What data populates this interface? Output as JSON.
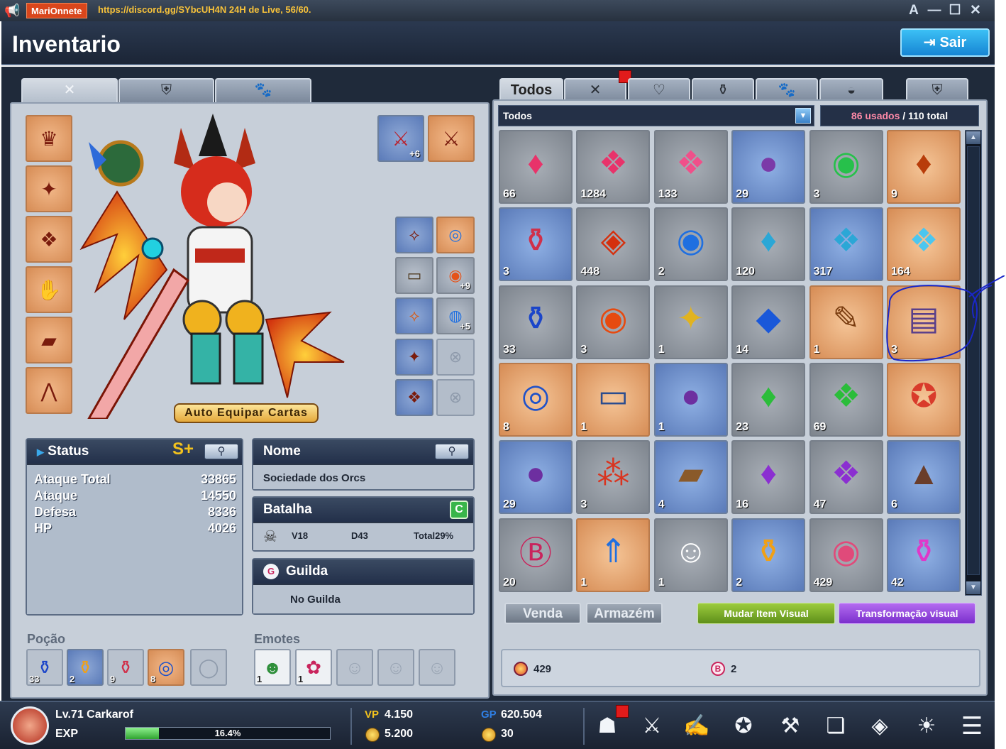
{
  "titlebar": {
    "app_name": "MariOnnete",
    "link_text": "https://discord.gg/SYbcUH4N 24H de Live, 56/60.",
    "controls": {
      "text_size": "A",
      "minimize": "—",
      "maximize": "☐",
      "close": "✕"
    }
  },
  "header": {
    "title": "Inventario",
    "exit_label": "Sair"
  },
  "left_tabs": [
    "weapon-icon",
    "armor-icon",
    "paw-icon"
  ],
  "equipment": {
    "auto_equip_label": "Auto Equipar Cartas",
    "weapon_upgrade": "+6",
    "accessory_upgrades": [
      "+9",
      "+5"
    ]
  },
  "status": {
    "title": "Status",
    "grade": "S+",
    "rows": [
      {
        "label": "Ataque Total",
        "value": "33865"
      },
      {
        "label": "Ataque",
        "value": "14550"
      },
      {
        "label": "Defesa",
        "value": "8336"
      },
      {
        "label": "HP",
        "value": "4026"
      }
    ]
  },
  "name_box": {
    "title": "Nome",
    "value": "Sociedade dos Orcs"
  },
  "battle_box": {
    "title": "Batalha",
    "v": "V18",
    "d": "D43",
    "total": "Total29%"
  },
  "guild_box": {
    "title": "Guilda",
    "value": "No Guilda"
  },
  "potions": {
    "title": "Poção",
    "items": [
      "33",
      "2",
      "9",
      "8"
    ]
  },
  "emotes": {
    "title": "Emotes",
    "items": [
      "1",
      "1"
    ]
  },
  "inventory": {
    "tab_all": "Todos",
    "filter_value": "Todos",
    "used": "86 usados",
    "total": " / 110 total",
    "items": [
      {
        "q": "66",
        "c": "gray",
        "i": "pink-crystal-icon",
        "g": "♦",
        "col": "#e8336a"
      },
      {
        "q": "1284",
        "c": "gray",
        "i": "pink-crystal-cluster-icon",
        "g": "❖",
        "col": "#e8336a"
      },
      {
        "q": "133",
        "c": "gray",
        "i": "pink-crystal-cluster-icon",
        "g": "❖",
        "col": "#f0508a"
      },
      {
        "q": "29",
        "c": "blue",
        "i": "purple-orb-icon",
        "g": "●",
        "col": "#7b3aa8"
      },
      {
        "q": "3",
        "c": "gray",
        "i": "green-orb-icon",
        "g": "◉",
        "col": "#27c04b"
      },
      {
        "q": "9",
        "c": "orange",
        "i": "orange-gem-icon",
        "g": "♦",
        "col": "#b83d0a"
      },
      {
        "q": "3",
        "c": "blue",
        "i": "red-potion-icon",
        "g": "⚱",
        "col": "#d0304a"
      },
      {
        "q": "448",
        "c": "gray",
        "i": "red-mask-icon",
        "g": "◈",
        "col": "#d4300e"
      },
      {
        "q": "2",
        "c": "gray",
        "i": "blue-orb-icon",
        "g": "◉",
        "col": "#1f6fe0"
      },
      {
        "q": "120",
        "c": "gray",
        "i": "cyan-crystal-icon",
        "g": "♦",
        "col": "#2ba7d6"
      },
      {
        "q": "317",
        "c": "blue",
        "i": "cyan-crystal-cluster-icon",
        "g": "❖",
        "col": "#2ba7d6"
      },
      {
        "q": "164",
        "c": "orange",
        "i": "cyan-crystal-cluster-icon",
        "g": "❖",
        "col": "#4cc6ef"
      },
      {
        "q": "33",
        "c": "gray",
        "i": "blue-potion-icon",
        "g": "⚱",
        "col": "#1b45c9"
      },
      {
        "q": "3",
        "c": "gray",
        "i": "fire-orb-icon",
        "g": "◉",
        "col": "#e64a10"
      },
      {
        "q": "1",
        "c": "gray",
        "i": "gold-pieces-icon",
        "g": "✦",
        "col": "#e1b31f"
      },
      {
        "q": "14",
        "c": "gray",
        "i": "blue-diamond-icon",
        "g": "◆",
        "col": "#1a58d9"
      },
      {
        "q": "1",
        "c": "orange",
        "i": "scroll-icon",
        "g": "✎",
        "col": "#7a3d10"
      },
      {
        "q": "3",
        "c": "orange",
        "i": "scroll-icon",
        "g": "▤",
        "col": "#5a3f8a"
      },
      {
        "q": "8",
        "c": "orange",
        "i": "ring-icon",
        "g": "◎",
        "col": "#1f52c9"
      },
      {
        "q": "1",
        "c": "orange",
        "i": "ticket-icon",
        "g": "▭",
        "col": "#2b4d8f"
      },
      {
        "q": "1",
        "c": "blue",
        "i": "purple-orb-icon",
        "g": "●",
        "col": "#6d2fa0"
      },
      {
        "q": "23",
        "c": "gray",
        "i": "green-crystal-icon",
        "g": "♦",
        "col": "#2bbd3a"
      },
      {
        "q": "69",
        "c": "gray",
        "i": "green-crystal-cluster-icon",
        "g": "❖",
        "col": "#2bbd3a"
      },
      {
        "q": "",
        "c": "orange",
        "i": "gc-club-badge-icon",
        "g": "✪",
        "col": "#d93b2b"
      },
      {
        "q": "29",
        "c": "blue",
        "i": "purple-orb-icon",
        "g": "●",
        "col": "#6d2fa0"
      },
      {
        "q": "3",
        "c": "gray",
        "i": "red-powder-icon",
        "g": "⁂",
        "col": "#d9341f"
      },
      {
        "q": "4",
        "c": "blue",
        "i": "treasure-map-icon",
        "g": "▰",
        "col": "#8a5a2a"
      },
      {
        "q": "16",
        "c": "gray",
        "i": "purple-crystal-icon",
        "g": "♦",
        "col": "#8b2fd1"
      },
      {
        "q": "47",
        "c": "gray",
        "i": "purple-crystal-cluster-icon",
        "g": "❖",
        "col": "#8b2fd1"
      },
      {
        "q": "6",
        "c": "blue",
        "i": "cannon-icon",
        "g": "▲",
        "col": "#6a3d2a"
      },
      {
        "q": "20",
        "c": "gray",
        "i": "b-coin-icon",
        "g": "Ⓑ",
        "col": "#c9245c"
      },
      {
        "q": "1",
        "c": "orange",
        "i": "up-scroll-icon",
        "g": "⇑",
        "col": "#1f6fe0"
      },
      {
        "q": "1",
        "c": "gray",
        "i": "white-ghost-icon",
        "g": "☺",
        "col": "#ffffff"
      },
      {
        "q": "2",
        "c": "blue",
        "i": "yellow-potion-icon",
        "g": "⚱",
        "col": "#f0a017"
      },
      {
        "q": "429",
        "c": "gray",
        "i": "rainbow-coin-icon",
        "g": "◉",
        "col": "#e04a7a"
      },
      {
        "q": "42",
        "c": "blue",
        "i": "pink-potion-icon",
        "g": "⚱",
        "col": "#e038c9"
      }
    ],
    "buttons": {
      "sell": "Venda",
      "storage": "Armazém",
      "change_visual": "Mudar Item Visual",
      "transform_visual": "Transformação visual"
    },
    "currencies": {
      "gem": "429",
      "b_coin": "2"
    }
  },
  "bottom": {
    "level_name": "Lv.71 Carkarof",
    "exp_label": "EXP",
    "exp_percent": "16.4%",
    "exp_fraction": 0.164,
    "vp_label": "VP",
    "vp": "4.150",
    "gold": "5.200",
    "gp_label": "GP",
    "gp": "620.504",
    "coin": "30",
    "menu_icons": [
      "character-icon",
      "skills-icon",
      "quest-icon",
      "gift-shop-icon",
      "auction-icon",
      "album-icon",
      "guild-icon",
      "collection-icon",
      "menu-icon"
    ]
  }
}
